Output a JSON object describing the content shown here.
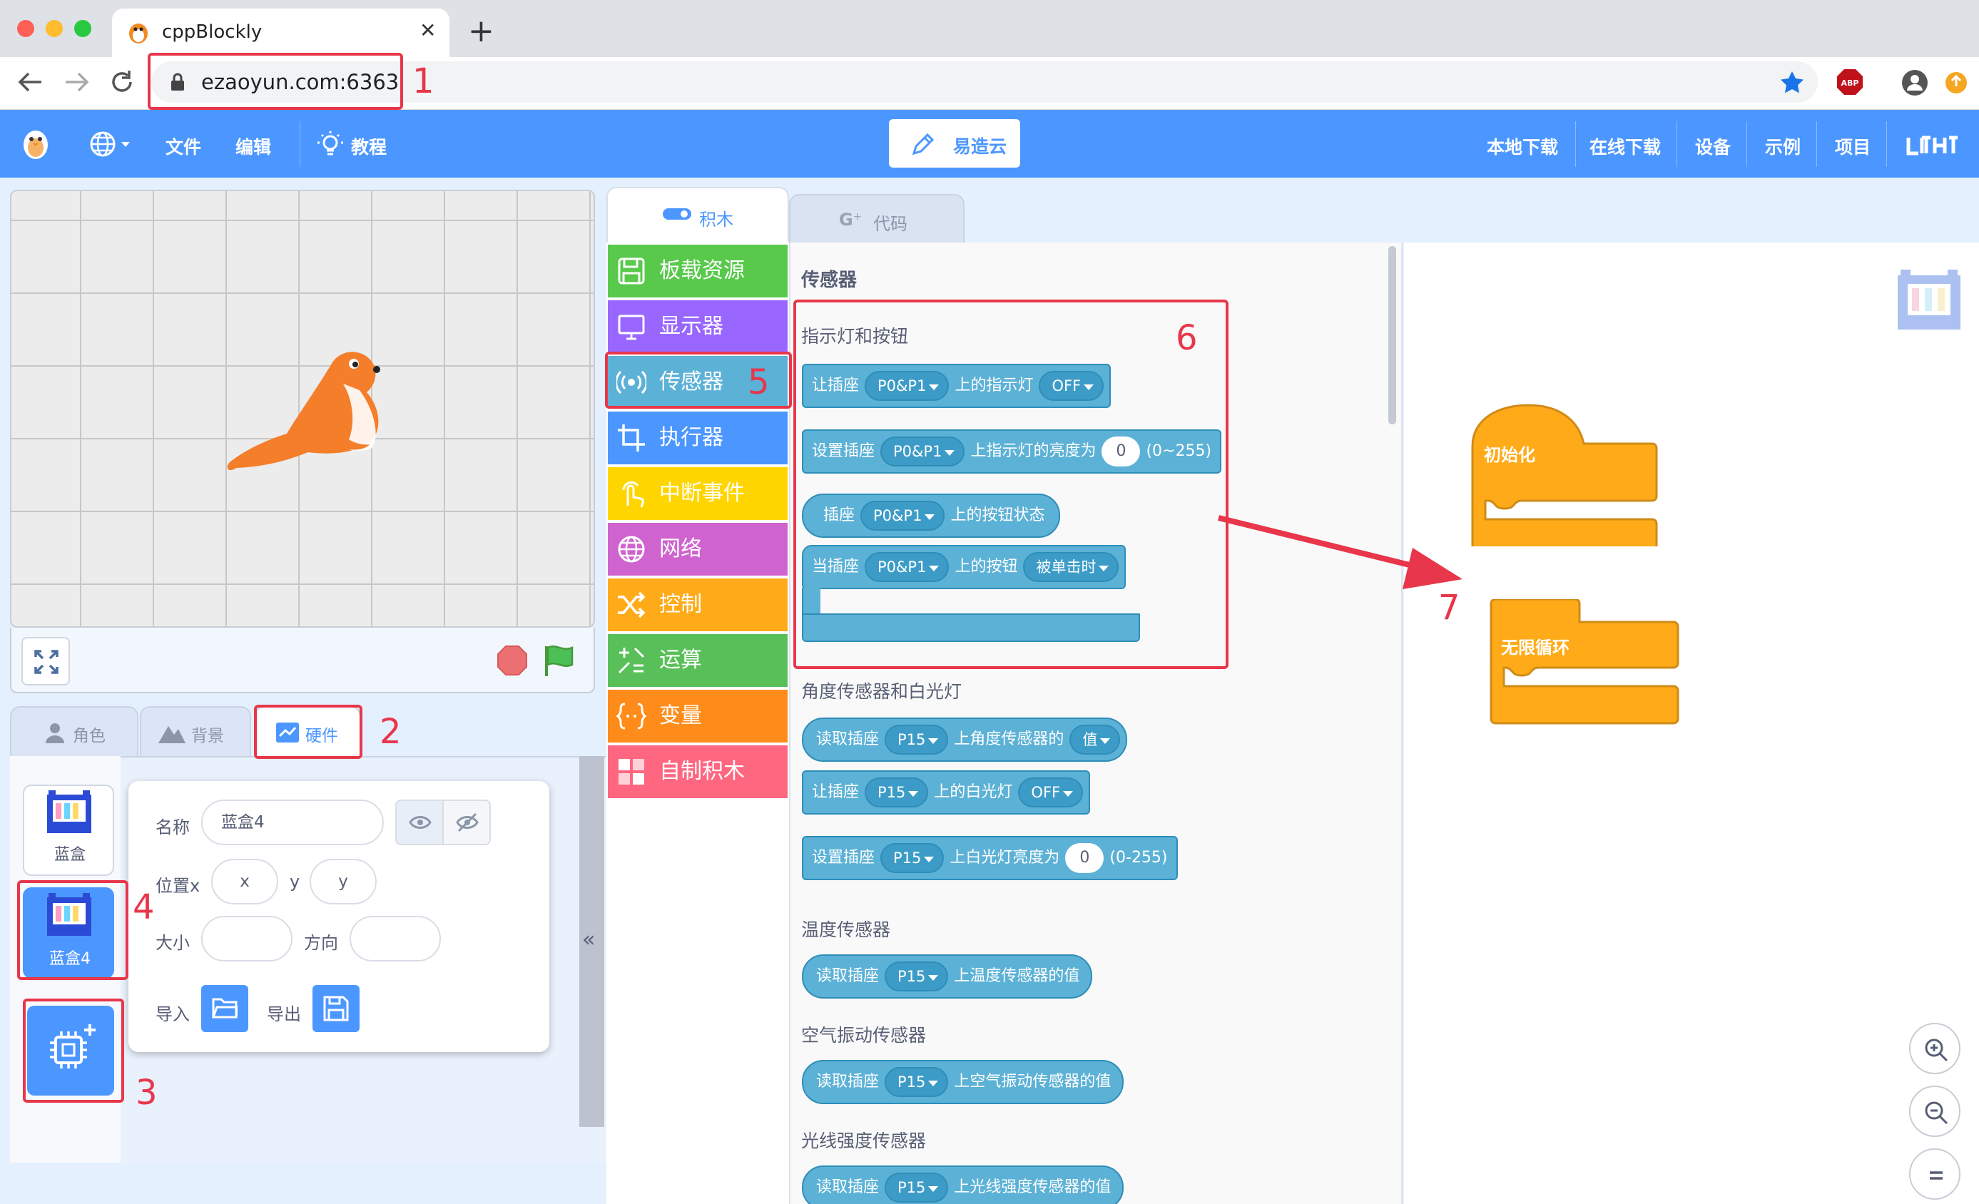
{
  "browser": {
    "tab_title": "cppBlockly",
    "url": "ezaoyun.com:6363",
    "new_tab": "+",
    "close": "✕"
  },
  "menu": {
    "file": "文件",
    "edit": "编辑",
    "tutorial": "教程",
    "cloud": "易造云",
    "right": [
      "本地下载",
      "在线下载",
      "设备",
      "示例",
      "项目"
    ]
  },
  "left_tabs": {
    "sprite": "角色",
    "backdrop": "背景",
    "hardware": "硬件"
  },
  "sprites": [
    {
      "name": "蓝盒"
    },
    {
      "name": "蓝盒4"
    }
  ],
  "info": {
    "name_label": "名称",
    "name_value": "蓝盒4",
    "posx_label": "位置x",
    "x_placeholder": "x",
    "y_label": "y",
    "y_placeholder": "y",
    "size_label": "大小",
    "dir_label": "方向",
    "import_label": "导入",
    "export_label": "导出"
  },
  "editor_tabs": {
    "blocks": "积木",
    "code": "代码"
  },
  "categories": [
    {
      "label": "板载资源",
      "color": "#58c94b"
    },
    {
      "label": "显示器",
      "color": "#9966ff"
    },
    {
      "label": "传感器",
      "color": "#5cb1d6"
    },
    {
      "label": "执行器",
      "color": "#4c97ff"
    },
    {
      "label": "中断事件",
      "color": "#ffd500"
    },
    {
      "label": "网络",
      "color": "#cf63cf"
    },
    {
      "label": "控制",
      "color": "#ffab19"
    },
    {
      "label": "运算",
      "color": "#59c059"
    },
    {
      "label": "变量",
      "color": "#ff8c1a"
    },
    {
      "label": "自制积木",
      "color": "#ff6680"
    }
  ],
  "flyout": {
    "heading": "传感器",
    "sec1": "指示灯和按钮",
    "b1": {
      "a": "让插座",
      "dd": "P0&P1",
      "b": "上的指示灯",
      "dd2": "OFF"
    },
    "b2": {
      "a": "设置插座",
      "dd": "P0&P1",
      "b": "上指示灯的亮度为",
      "num": "0",
      "c": "(0~255)"
    },
    "b3": {
      "a": "插座",
      "dd": "P0&P1",
      "b": "上的按钮状态"
    },
    "b4": {
      "a": "当插座",
      "dd": "P0&P1",
      "b": "上的按钮",
      "dd2": "被单击时"
    },
    "sec2": "角度传感器和白光灯",
    "b5": {
      "a": "读取插座",
      "dd": "P15",
      "b": "上角度传感器的",
      "dd2": "值"
    },
    "b6": {
      "a": "让插座",
      "dd": "P15",
      "b": "上的白光灯",
      "dd2": "OFF"
    },
    "b7": {
      "a": "设置插座",
      "dd": "P15",
      "b": "上白光灯亮度为",
      "num": "0",
      "c": "(0-255)"
    },
    "sec3": "温度传感器",
    "b8": {
      "a": "读取插座",
      "dd": "P15",
      "b": "上温度传感器的值"
    },
    "sec4": "空气振动传感器",
    "b9": {
      "a": "读取插座",
      "dd": "P15",
      "b": "上空气振动传感器的值"
    },
    "sec5": "光线强度传感器",
    "b10": {
      "a": "读取插座",
      "dd": "P15",
      "b": "上光线强度传感器的值"
    }
  },
  "workspace": {
    "init": "初始化",
    "loop": "无限循环"
  },
  "annotations": [
    "1",
    "2",
    "3",
    "4",
    "5",
    "6",
    "7"
  ],
  "colors": {
    "accent": "#4c97ff",
    "sensor": "#5cb1d6",
    "control": "#ffab19",
    "annotation": "#e8364a"
  }
}
